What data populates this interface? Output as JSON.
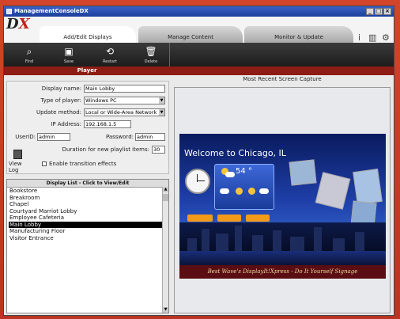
{
  "window": {
    "title": "ManagementConsoleDX",
    "minimize": "_",
    "maximize": "□",
    "close": "×"
  },
  "logo": {
    "text_d": "D",
    "text_x": "X"
  },
  "tabs": [
    {
      "label": "Add/Edit Displays"
    },
    {
      "label": "Manage Content"
    },
    {
      "label": "Monitor & Update"
    }
  ],
  "header_icons": {
    "info": "i",
    "library": "▥",
    "settings": "⚙"
  },
  "toolbar": [
    {
      "label": "Find",
      "icon": "search-icon"
    },
    {
      "label": "Save",
      "icon": "save-icon"
    },
    {
      "label": "Restart",
      "icon": "restart-icon"
    },
    {
      "label": "Delete",
      "icon": "trash-icon"
    }
  ],
  "section_title": "Player",
  "form": {
    "display_name_label": "Display name:",
    "display_name_value": "Main Lobby",
    "type_label": "Type of player:",
    "type_value": "Windows PC",
    "update_label": "Update method:",
    "update_value": "Local or Wide-Area Network",
    "ip_label": "IP Address:",
    "ip_value": "192.168.1.5",
    "user_label": "UserID:",
    "user_value": "admin",
    "password_label": "Password:",
    "password_value": "admin",
    "duration_label": "Duration for new playlist items:",
    "duration_value": "30",
    "view_log_label": "View Log",
    "transition_label": "Enable transition effects",
    "transition_checked": false
  },
  "display_list": {
    "header": "Display List - Click to View/Edit",
    "items": [
      "Bookstore",
      "Breakroom",
      "Chapel",
      "Courtyard Marriot Lobby",
      "Employee Cafeteria",
      "Main Lobby",
      "Manufacturing Floor",
      "Visitor Entrance"
    ],
    "selected_index": 5
  },
  "capture": {
    "caption": "Most Recent Screen Capture",
    "welcome": "Welcome to Chicago, IL",
    "temperature": "54 °",
    "banner": "Best Wave's DisplayIt!Xpress - Do It Yourself Signage"
  },
  "colors": {
    "brand_red": "#8c1c14",
    "frame_red": "#c9402a",
    "selected_bg": "#000000"
  }
}
